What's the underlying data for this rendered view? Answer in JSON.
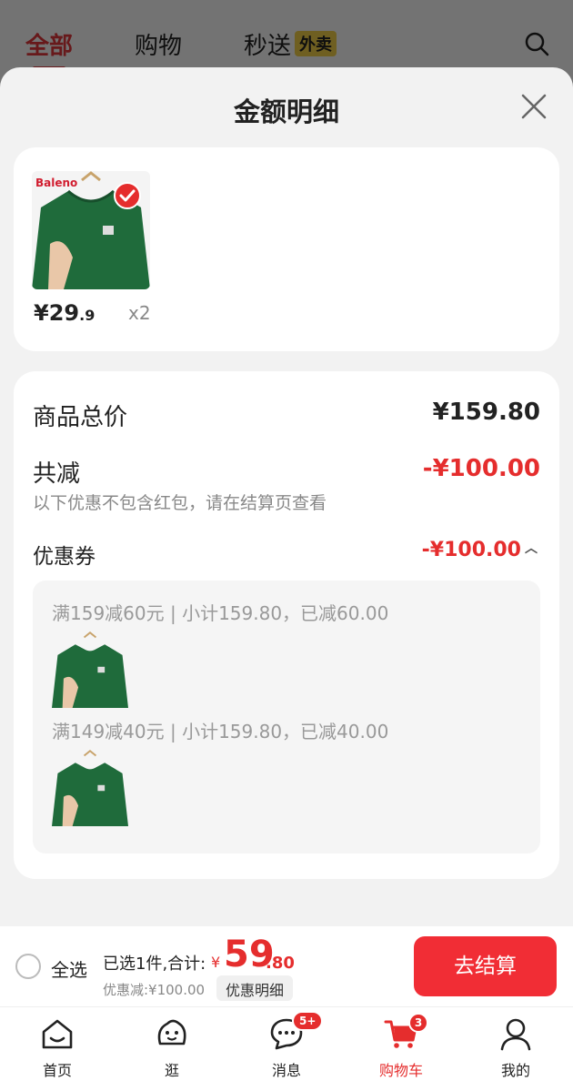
{
  "top_tabs": [
    {
      "label": "全部"
    },
    {
      "label": "购物"
    },
    {
      "label": "秒送"
    }
  ],
  "top_badge": "外卖",
  "sheet": {
    "title": "金额明细"
  },
  "item": {
    "brand": "Baleno",
    "price_int": "¥29",
    "price_dec": ".9",
    "qty": "x2"
  },
  "summary": {
    "total_label": "商品总价",
    "total_value": "¥159.80",
    "reduce_label": "共减",
    "reduce_value": "-¥100.00",
    "note": "以下优惠不包含红包，请在结算页查看",
    "coupon_label": "优惠券",
    "coupon_value": "-¥100.00"
  },
  "coupons": [
    {
      "rule": "满159减60元 | 小计159.80，已减60.00"
    },
    {
      "rule": "满149减40元 | 小计159.80，已减40.00"
    }
  ],
  "checkout": {
    "select_all": "全选",
    "selected": "已选1件,合计:",
    "yen": "¥",
    "total_int": "59",
    "total_dec": ".80",
    "discount": "优惠减:¥100.00",
    "detail_button": "优惠明细",
    "checkout_button": "去结算"
  },
  "nav": [
    {
      "label": "首页",
      "icon": "home-icon"
    },
    {
      "label": "逛",
      "icon": "browse-icon"
    },
    {
      "label": "消息",
      "icon": "message-icon",
      "badge": "5+"
    },
    {
      "label": "购物车",
      "icon": "cart-icon",
      "badge": "3"
    },
    {
      "label": "我的",
      "icon": "profile-icon"
    }
  ],
  "colors": {
    "accent_red": "#e52d2d",
    "checkout_button": "#f12d35",
    "shirt_green": "#1f6b3b"
  }
}
